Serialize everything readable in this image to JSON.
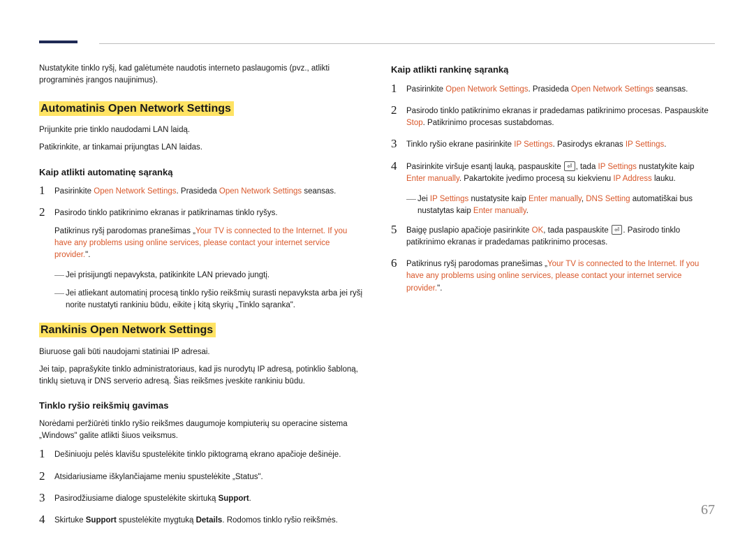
{
  "intro": "Nustatykite tinklo ryšį, kad galėtumėte naudotis interneto paslaugomis (pvz., atlikti programinės įrangos naujinimus).",
  "sectionA": {
    "heading": "Automatinis Open Network Settings",
    "p1": "Prijunkite prie tinklo naudodami LAN laidą.",
    "p2": "Patikrinkite, ar tinkamai prijungtas LAN laidas.",
    "sub1": "Kaip atlikti automatinę sąranką",
    "step1_a": "Pasirinkite ",
    "step1_b": "Open Network Settings",
    "step1_c": ". Prasideda ",
    "step1_d": "Open Network Settings",
    "step1_e": " seansas.",
    "step2": "Pasirodo tinklo patikrinimo ekranas ir patikrinamas tinklo ryšys.",
    "step2_sub_a": "Patikrinus ryšį parodomas pranešimas „",
    "step2_sub_b": "Your TV is connected to the Internet. If you have any problems using online services, please contact your internet service provider.",
    "step2_sub_c": "\".",
    "dash1": "Jei prisijungti nepavyksta, patikinkite LAN prievado jungtį.",
    "dash2": "Jei atliekant automatinį procesą tinklo ryšio reikšmių surasti nepavyksta arba jei ryšį norite nustatyti rankiniu būdu, eikite į kitą skyrių „Tinklo sąranka\"."
  },
  "sectionB": {
    "heading": "Rankinis Open Network Settings",
    "p1": "Biuruose gali būti naudojami statiniai IP adresai.",
    "p2": "Jei taip, paprašykite tinklo administratoriaus, kad jis nurodytų IP adresą, potinklio šabloną, tinklų sietuvą ir DNS serverio adresą. Šias reikšmes įveskite rankiniu būdu.",
    "sub1": "Tinklo ryšio reikšmių gavimas",
    "p3": "Norėdami peržiūrėti tinklo ryšio reikšmes daugumoje kompiuterių su operacine sistema „Windows\" galite atlikti šiuos veiksmus.",
    "step1": "Dešiniuoju pelės klavišu spustelėkite tinklo piktogramą ekrano apačioje dešinėje.",
    "step2": "Atsidariusiame iškylančiajame meniu spustelėkite „Status\".",
    "step3_a": "Pasirodžiusiame dialoge spustelėkite skirtuką ",
    "step3_b": "Support",
    "step3_c": ".",
    "step4_a": "Skirtuke ",
    "step4_b": "Support",
    "step4_c": " spustelėkite mygtuką ",
    "step4_d": "Details",
    "step4_e": ". Rodomos tinklo ryšio reikšmės."
  },
  "sectionC": {
    "sub1": "Kaip atlikti rankinę sąranką",
    "step1_a": "Pasirinkite ",
    "step1_b": "Open Network Settings",
    "step1_c": ". Prasideda ",
    "step1_d": "Open Network Settings",
    "step1_e": " seansas.",
    "step2_a": "Pasirodo tinklo patikrinimo ekranas ir pradedamas patikrinimo procesas. Paspauskite ",
    "step2_b": "Stop",
    "step2_c": ". Patikrinimo procesas sustabdomas.",
    "step3_a": "Tinklo ryšio ekrane pasirinkite ",
    "step3_b": "IP Settings",
    "step3_c": ". Pasirodys ekranas ",
    "step3_d": "IP Settings",
    "step3_e": ".",
    "step4_a": "Pasirinkite viršuje esantį lauką, paspauskite ",
    "step4_b": ", tada ",
    "step4_c": "IP Settings",
    "step4_d": " nustatykite kaip ",
    "step4_e": "Enter manually",
    "step4_f": ". Pakartokite įvedimo procesą su kiekvienu ",
    "step4_g": "IP Address",
    "step4_h": " lauku.",
    "dash1_a": "Jei ",
    "dash1_b": "IP Settings",
    "dash1_c": " nustatysite kaip ",
    "dash1_d": "Enter manually",
    "dash1_e": ", ",
    "dash1_f": "DNS Setting",
    "dash1_g": " automatiškai bus nustatytas kaip ",
    "dash1_h": "Enter manually",
    "dash1_i": ".",
    "step5_a": "Baigę puslapio apačioje pasirinkite ",
    "step5_b": "OK",
    "step5_c": ", tada paspauskite ",
    "step5_d": ". Pasirodo tinklo patikrinimo ekranas ir pradedamas patikrinimo procesas.",
    "step6_a": "Patikrinus ryšį parodomas pranešimas „",
    "step6_b": "Your TV is connected to the Internet. If you have any problems using online services, please contact your internet service provider.",
    "step6_c": "\"."
  },
  "enterGlyph": "⏎",
  "pageNumber": "67"
}
